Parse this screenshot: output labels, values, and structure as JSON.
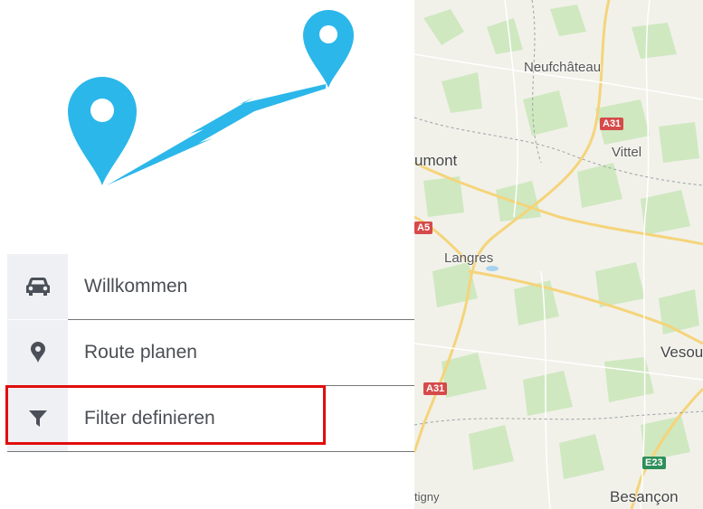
{
  "menu": {
    "items": [
      {
        "label": "Willkommen",
        "icon": "car-icon"
      },
      {
        "label": "Route planen",
        "icon": "map-pin-icon"
      },
      {
        "label": "Filter definieren",
        "icon": "filter-icon"
      }
    ]
  },
  "map": {
    "towns": {
      "neufchateau": "Neufchâteau",
      "vittel": "Vittel",
      "chaumont_partial": "umont",
      "langres": "Langres",
      "vesoul_partial": "Vesou",
      "besancon": "Besançon",
      "partial_bottom_left": "tigny"
    },
    "roads": {
      "a31_top": "A31",
      "a5": "A5",
      "a31_bottom": "A31",
      "e23": "E23"
    }
  },
  "colors": {
    "brand_blue": "#2bb7ea",
    "highlight_red": "#e10d0d"
  }
}
